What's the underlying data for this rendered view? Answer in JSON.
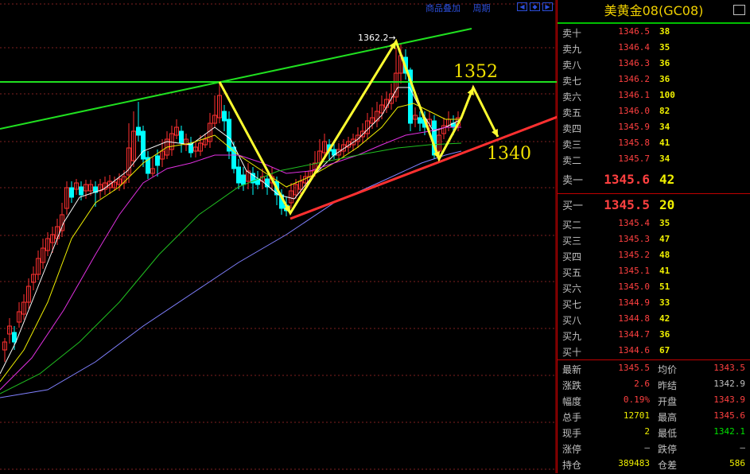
{
  "toolbar": {
    "link1": "商品叠加",
    "link2": "周期"
  },
  "chart": {
    "peak_label": "1362.2",
    "annotation_high": "1352",
    "annotation_low": "1340",
    "colors": {
      "up": "#ff3030",
      "down": "#00ffff",
      "yellow_arrow": "#ffff30",
      "green_line": "#20e020",
      "red_line": "#ff3030"
    }
  },
  "panel": {
    "title": "美黄金08(GC08)",
    "asks": [
      {
        "label": "卖十",
        "price": "1346.5",
        "vol": "38"
      },
      {
        "label": "卖九",
        "price": "1346.4",
        "vol": "35"
      },
      {
        "label": "卖八",
        "price": "1346.3",
        "vol": "36"
      },
      {
        "label": "卖七",
        "price": "1346.2",
        "vol": "36"
      },
      {
        "label": "卖六",
        "price": "1346.1",
        "vol": "100"
      },
      {
        "label": "卖五",
        "price": "1346.0",
        "vol": "82"
      },
      {
        "label": "卖四",
        "price": "1345.9",
        "vol": "34"
      },
      {
        "label": "卖三",
        "price": "1345.8",
        "vol": "41"
      },
      {
        "label": "卖二",
        "price": "1345.7",
        "vol": "34"
      },
      {
        "label": "卖一",
        "price": "1345.6",
        "vol": "42"
      }
    ],
    "bids": [
      {
        "label": "买一",
        "price": "1345.5",
        "vol": "20"
      },
      {
        "label": "买二",
        "price": "1345.4",
        "vol": "35"
      },
      {
        "label": "买三",
        "price": "1345.3",
        "vol": "47"
      },
      {
        "label": "买四",
        "price": "1345.2",
        "vol": "48"
      },
      {
        "label": "买五",
        "price": "1345.1",
        "vol": "41"
      },
      {
        "label": "买六",
        "price": "1345.0",
        "vol": "51"
      },
      {
        "label": "买七",
        "price": "1344.9",
        "vol": "33"
      },
      {
        "label": "买八",
        "price": "1344.8",
        "vol": "42"
      },
      {
        "label": "买九",
        "price": "1344.7",
        "vol": "36"
      },
      {
        "label": "买十",
        "price": "1344.6",
        "vol": "67"
      }
    ],
    "stats": [
      {
        "l": "最新",
        "lv": "1345.5",
        "lc": "#ff4040",
        "r": "均价",
        "rv": "1343.5",
        "rc": "#ff4040"
      },
      {
        "l": "涨跌",
        "lv": "2.6",
        "lc": "#ff4040",
        "r": "昨结",
        "rv": "1342.9",
        "rc": "#c0c0c0"
      },
      {
        "l": "幅度",
        "lv": "0.19%",
        "lc": "#ff4040",
        "r": "开盘",
        "rv": "1343.9",
        "rc": "#ff4040"
      },
      {
        "l": "总手",
        "lv": "12701",
        "lc": "#f0f000",
        "r": "最高",
        "rv": "1345.6",
        "rc": "#ff4040"
      },
      {
        "l": "现手",
        "lv": "2",
        "lc": "#f0f000",
        "r": "最低",
        "rv": "1342.1",
        "rc": "#00e000"
      },
      {
        "l": "涨停",
        "lv": "—",
        "lc": "#c0c0c0",
        "r": "跌停",
        "rv": "—",
        "rc": "#c0c0c0"
      },
      {
        "l": "持仓",
        "lv": "389483",
        "lc": "#f0f000",
        "r": "仓差",
        "rv": "586",
        "rc": "#f0f000"
      }
    ]
  }
}
